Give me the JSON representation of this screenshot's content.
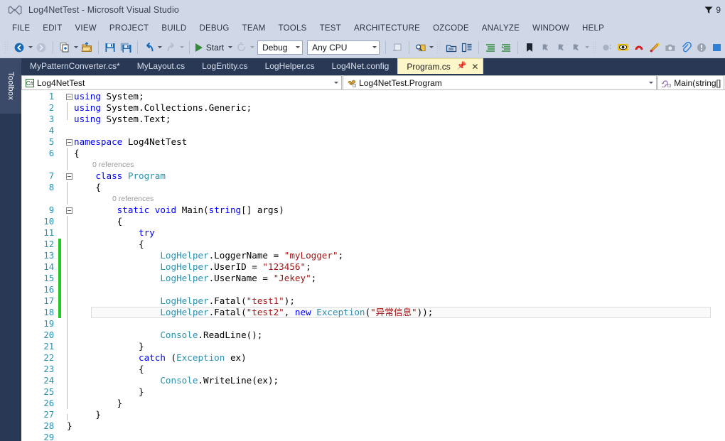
{
  "window": {
    "title": "Log4NetTest - Microsoft Visual Studio",
    "logo_icon": "visual-studio-logo",
    "notification_icon": "notification-flag-icon",
    "notification_count": "9"
  },
  "menubar": {
    "items": [
      {
        "label": "FILE"
      },
      {
        "label": "EDIT"
      },
      {
        "label": "VIEW"
      },
      {
        "label": "PROJECT"
      },
      {
        "label": "BUILD"
      },
      {
        "label": "DEBUG"
      },
      {
        "label": "TEAM"
      },
      {
        "label": "TOOLS"
      },
      {
        "label": "TEST"
      },
      {
        "label": "ARCHITECTURE"
      },
      {
        "label": "OZCODE"
      },
      {
        "label": "ANALYZE"
      },
      {
        "label": "WINDOW"
      },
      {
        "label": "HELP"
      }
    ]
  },
  "toolbar": {
    "navigate_back_icon": "navigate-back-icon",
    "navigate_forward_icon": "navigate-forward-icon",
    "new_project_icon": "new-project-icon",
    "open_file_icon": "open-file-icon",
    "save_icon": "save-icon",
    "save_all_icon": "save-all-icon",
    "undo_icon": "undo-icon",
    "redo_icon": "redo-icon",
    "start_label": "Start",
    "start_icon": "play-icon",
    "restart_icon": "restart-icon",
    "config_value": "Debug",
    "platform_value": "Any CPU",
    "step_icon": "step-into-icon",
    "find_icon": "find-in-files-icon",
    "solution_explorer_icon": "solution-explorer-icon",
    "properties_icon": "properties-window-icon",
    "comment_icon": "comment-selection-icon",
    "uncomment_icon": "uncomment-selection-icon",
    "bookmark_icon": "bookmark-icon",
    "prev_bookmark_icon": "previous-bookmark-icon",
    "next_bookmark_icon": "next-bookmark-icon",
    "clear_bookmarks_icon": "clear-bookmarks-icon",
    "breakpoint_icon": "breakpoint-icon",
    "ozcode_reveal_icon": "ozcode-reveal-icon",
    "ozcode_magnet_icon": "ozcode-magnet-icon",
    "ozcode_magic_icon": "ozcode-magic-wand-icon",
    "ozcode_camera_icon": "ozcode-camera-icon",
    "ozcode_link_icon": "ozcode-link-icon",
    "ozcode_info_icon": "ozcode-info-icon",
    "overflow_icon": "toolbar-overflow-icon"
  },
  "sidebar": {
    "toolbox_label": "Toolbox"
  },
  "tabs": [
    {
      "label": "MyPatternConverter.cs*",
      "active": false
    },
    {
      "label": "MyLayout.cs",
      "active": false
    },
    {
      "label": "LogEntity.cs",
      "active": false
    },
    {
      "label": "LogHelper.cs",
      "active": false
    },
    {
      "label": "Log4Net.config",
      "active": false
    },
    {
      "label": "Program.cs",
      "active": true,
      "pin_icon": "pin-icon",
      "close_icon": "close-icon"
    }
  ],
  "navbar": {
    "project": {
      "icon": "csharp-project-icon",
      "value": "Log4NetTest"
    },
    "type": {
      "icon": "class-icon",
      "value": "Log4NetTest.Program"
    },
    "member": {
      "icon": "method-icon",
      "value": "Main(string[] args"
    }
  },
  "editor": {
    "codelens_class": "0 references",
    "codelens_method": "0 references",
    "current_line": 18,
    "changed_lines": [
      12,
      13,
      14,
      15,
      16,
      17,
      18
    ],
    "lines": [
      {
        "n": 1,
        "text": "using System;"
      },
      {
        "n": 2,
        "text": "using System.Collections.Generic;"
      },
      {
        "n": 3,
        "text": "using System.Text;"
      },
      {
        "n": 4,
        "text": ""
      },
      {
        "n": 5,
        "text": "namespace Log4NetTest"
      },
      {
        "n": 6,
        "text": "{"
      },
      {
        "n": 7,
        "text": "    class Program"
      },
      {
        "n": 8,
        "text": "    {"
      },
      {
        "n": 9,
        "text": "        static void Main(string[] args)"
      },
      {
        "n": 10,
        "text": "        {"
      },
      {
        "n": 11,
        "text": "            try"
      },
      {
        "n": 12,
        "text": "            {"
      },
      {
        "n": 13,
        "text": "                LogHelper.LoggerName = \"myLogger\";"
      },
      {
        "n": 14,
        "text": "                LogHelper.UserID = \"123456\";"
      },
      {
        "n": 15,
        "text": "                LogHelper.UserName = \"Jekey\";"
      },
      {
        "n": 16,
        "text": ""
      },
      {
        "n": 17,
        "text": "                LogHelper.Fatal(\"test1\");"
      },
      {
        "n": 18,
        "text": "                LogHelper.Fatal(\"test2\", new Exception(\"异常信息\"));"
      },
      {
        "n": 19,
        "text": ""
      },
      {
        "n": 20,
        "text": "                Console.ReadLine();"
      },
      {
        "n": 21,
        "text": "            }"
      },
      {
        "n": 22,
        "text": "            catch (Exception ex)"
      },
      {
        "n": 23,
        "text": "            {"
      },
      {
        "n": 24,
        "text": "                Console.WriteLine(ex);"
      },
      {
        "n": 25,
        "text": "            }"
      },
      {
        "n": 26,
        "text": "        }"
      },
      {
        "n": 27,
        "text": "    }"
      },
      {
        "n": 28,
        "text": "}"
      },
      {
        "n": 29,
        "text": ""
      }
    ]
  },
  "colors": {
    "chrome": "#d0d8e8",
    "workspace": "#293955",
    "active_tab": "#fdf6c8",
    "keyword": "#0000ff",
    "type": "#2b91af",
    "string": "#a31515",
    "line_number": "#2b91af",
    "change_bar": "#23c623"
  }
}
